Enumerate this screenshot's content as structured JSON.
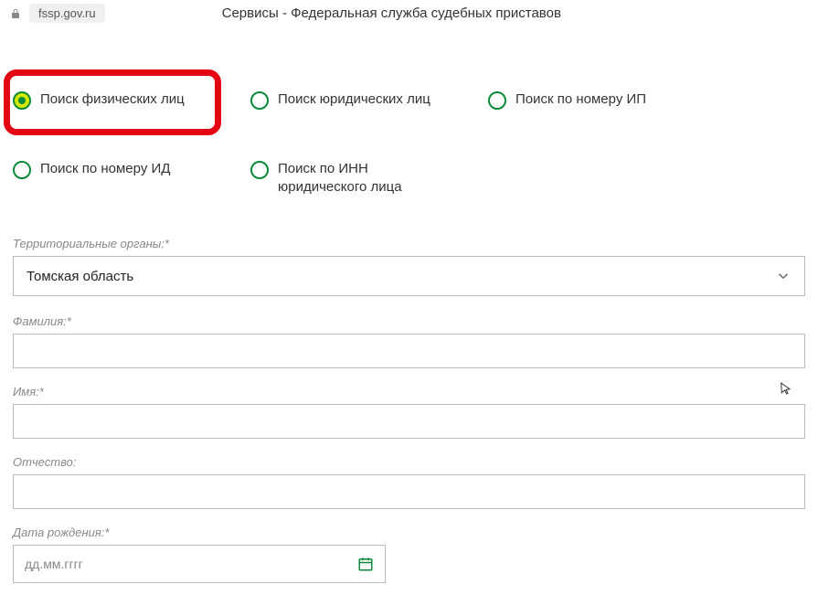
{
  "url": {
    "domain": "fssp.gov.ru"
  },
  "page_title": "Сервисы - Федеральная служба судебных приставов",
  "radios": [
    {
      "label": "Поиск физических лиц",
      "selected": true
    },
    {
      "label": "Поиск юридических лиц",
      "selected": false
    },
    {
      "label": "Поиск по номеру ИП",
      "selected": false
    },
    {
      "label": "Поиск по номеру ИД",
      "selected": false
    },
    {
      "label": "Поиск по ИНН юридического лица",
      "selected": false
    }
  ],
  "form": {
    "territory_label": "Территориальные органы:*",
    "territory_value": "Томская область",
    "lastname_label": "Фамилия:*",
    "lastname_value": "",
    "firstname_label": "Имя:*",
    "firstname_value": "",
    "patronymic_label": "Отчество:",
    "patronymic_value": "",
    "birthdate_label": "Дата рождения:*",
    "birthdate_placeholder": "дд.мм.гггг"
  }
}
